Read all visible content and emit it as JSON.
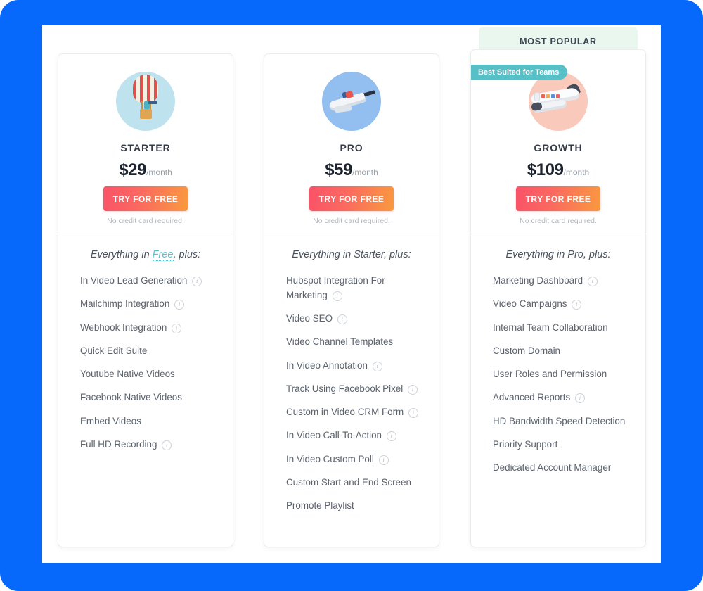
{
  "theme": {
    "page_background": "#0669fc",
    "panel_background": "#ffffff",
    "cta_gradient_start": "#fa5268",
    "cta_gradient_end": "#f99a3e",
    "badge_color": "#57bfc6",
    "ribbon_background": "#e9f7ef",
    "link_color": "#5bc0d0"
  },
  "popular_ribbon": {
    "label": "MOST POPULAR"
  },
  "plans": [
    {
      "id": "starter",
      "name": "STARTER",
      "price": "$29",
      "period": "/month",
      "cta_label": "TRY FOR FREE",
      "no_credit_card": "No credit card required.",
      "everything_prefix": "Everything in ",
      "everything_link": "Free",
      "everything_suffix": ", plus:",
      "illustration": "hot-air-balloon-illustration",
      "features": [
        {
          "label": "In Video Lead Generation",
          "info": true
        },
        {
          "label": "Mailchimp Integration",
          "info": true
        },
        {
          "label": "Webhook Integration",
          "info": true
        },
        {
          "label": "Quick Edit Suite",
          "info": false
        },
        {
          "label": "Youtube Native Videos",
          "info": false
        },
        {
          "label": "Facebook Native Videos",
          "info": false
        },
        {
          "label": "Embed Videos",
          "info": false
        },
        {
          "label": "Full HD Recording",
          "info": true
        }
      ]
    },
    {
      "id": "pro",
      "name": "PRO",
      "price": "$59",
      "period": "/month",
      "cta_label": "TRY FOR FREE",
      "no_credit_card": "No credit card required.",
      "everything_prefix": "Everything in ",
      "everything_link": "Starter",
      "everything_suffix": ", plus:",
      "illustration": "rocket-plane-illustration",
      "features": [
        {
          "label": "Hubspot Integration For Marketing",
          "info": true
        },
        {
          "label": "Video SEO",
          "info": true
        },
        {
          "label": "Video Channel Templates",
          "info": false
        },
        {
          "label": "In Video Annotation",
          "info": true
        },
        {
          "label": "Track Using Facebook Pixel",
          "info": true
        },
        {
          "label": "Custom in Video CRM Form",
          "info": true
        },
        {
          "label": "In Video Call-To-Action",
          "info": true
        },
        {
          "label": "In Video Custom Poll",
          "info": true
        },
        {
          "label": "Custom Start and End Screen",
          "info": false
        },
        {
          "label": "Promote Playlist",
          "info": false
        }
      ]
    },
    {
      "id": "growth",
      "name": "GROWTH",
      "price": "$109",
      "period": "/month",
      "cta_label": "TRY FOR FREE",
      "no_credit_card": "No credit card required.",
      "badge": "Best Suited for Teams",
      "everything_prefix": "Everything in ",
      "everything_link": "Pro",
      "everything_suffix": ", plus:",
      "illustration": "jet-airplane-illustration",
      "features": [
        {
          "label": "Marketing Dashboard",
          "info": true
        },
        {
          "label": "Video Campaigns",
          "info": true
        },
        {
          "label": "Internal Team Collaboration",
          "info": false
        },
        {
          "label": "Custom Domain",
          "info": false
        },
        {
          "label": "User Roles and Permission",
          "info": false
        },
        {
          "label": "Advanced Reports",
          "info": true
        },
        {
          "label": "HD Bandwidth Speed Detection",
          "info": false
        },
        {
          "label": "Priority Support",
          "info": false
        },
        {
          "label": "Dedicated Account Manager",
          "info": false
        }
      ]
    }
  ],
  "info_icon_glyph": "i"
}
